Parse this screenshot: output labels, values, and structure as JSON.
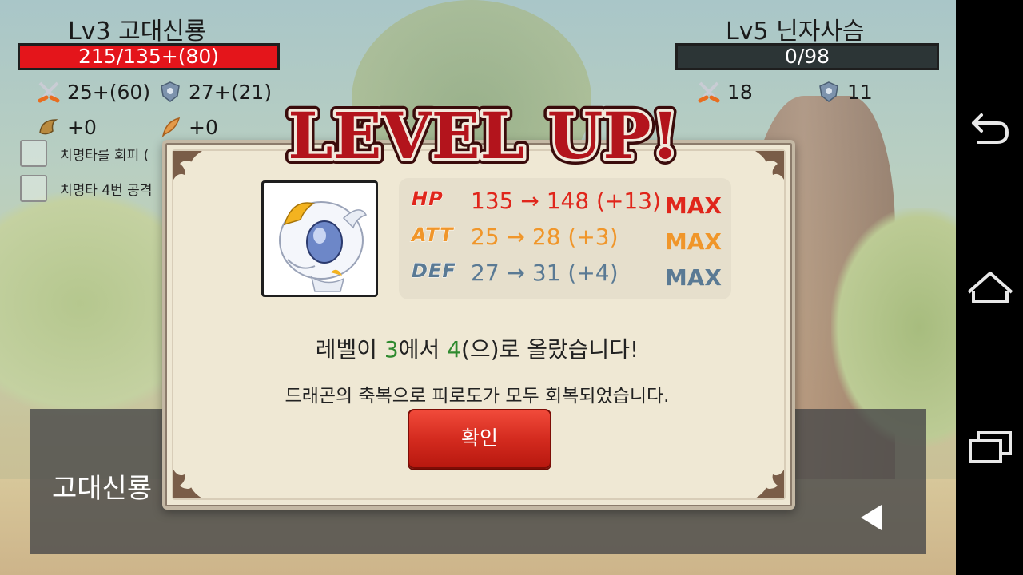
{
  "player": {
    "name": "Lv3 고대신룡",
    "hp_text": "215/135+(80)",
    "attack": "25+(60)",
    "defense": "27+(21)",
    "bonus1": "+0",
    "bonus2": "+0",
    "hp_color": "#e4151b"
  },
  "enemy": {
    "name": "Lv5 닌자사슴",
    "hp_text": "0/98",
    "attack": "18",
    "defense": "11"
  },
  "options": [
    {
      "label": "치명타를 회피 ("
    },
    {
      "label": "치명타 4번 공격"
    }
  ],
  "message_box": {
    "speaker": "고대신룡"
  },
  "dialog": {
    "banner": "LEVEL UP!",
    "stats": [
      {
        "label": "HP",
        "value": "135 → 148 (+13)",
        "max": "MAX",
        "color": "#e0261b"
      },
      {
        "label": "ATT",
        "value": "25 → 28 (+3)",
        "max": "MAX",
        "color": "#f0962a"
      },
      {
        "label": "DEF",
        "value": "27 → 31 (+4)",
        "max": "MAX",
        "color": "#5a7a94"
      }
    ],
    "level_message": {
      "prefix": "레벨이 ",
      "from": "3",
      "middle": "에서 ",
      "to": "4",
      "suffix": "(으)로 올랐습니다!"
    },
    "recover_message": "드래곤의 축복으로 피로도가 모두 회복되었습니다.",
    "confirm_label": "확인"
  },
  "navigation": {
    "back": "back-icon",
    "home": "home-icon",
    "recents": "recents-icon"
  }
}
